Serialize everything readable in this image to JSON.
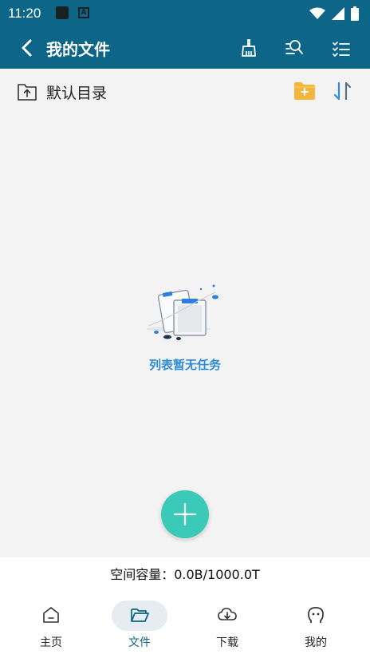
{
  "status_bar": {
    "time": "11:20"
  },
  "app_bar": {
    "title": "我的文件",
    "actions": [
      "broom-icon",
      "search-person-icon",
      "checklist-icon"
    ]
  },
  "directory": {
    "label": "默认目录"
  },
  "empty_state": {
    "message": "列表暂无任务"
  },
  "capacity": {
    "text": "空间容量：0.0B/1000.0T"
  },
  "bottom_nav": {
    "items": [
      {
        "label": "主页",
        "icon": "home-icon",
        "active": false
      },
      {
        "label": "文件",
        "icon": "folder-icon",
        "active": true
      },
      {
        "label": "下载",
        "icon": "cloud-download-icon",
        "active": false
      },
      {
        "label": "我的",
        "icon": "profile-icon",
        "active": false
      }
    ]
  },
  "colors": {
    "primary": "#0d6587",
    "fab": "#3ccab8",
    "accent_text": "#2d8bd8",
    "folder_yellow": "#f5b53a",
    "nav_active_bg": "#e5ecf2"
  }
}
